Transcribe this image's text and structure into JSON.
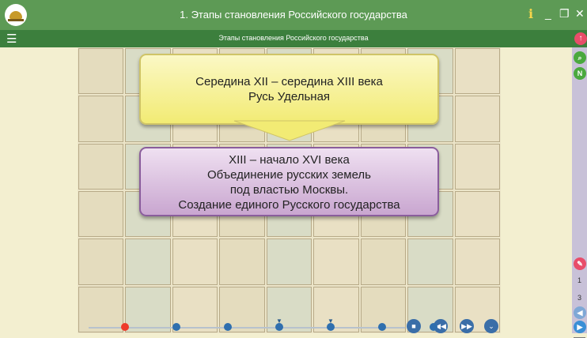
{
  "window": {
    "title": "1. Этапы становления Российского государства",
    "info_label": "i",
    "minimize_label": "_",
    "maximize_label": "❐",
    "close_label": "✕"
  },
  "subbar": {
    "menu_icon": "☰",
    "title": "Этапы становления Российского государства",
    "up_icon": "↑"
  },
  "callouts": [
    {
      "lines": [
        "Середина XII – середина XIII века",
        "Русь Удельная"
      ],
      "color": "#f2eb74"
    },
    {
      "lines": [
        "XIII – начало XVI века",
        "Объединение русских земель",
        "под властью Москвы.",
        "Создание единого Русского государства"
      ],
      "color": "#c9a6d0"
    }
  ],
  "sidebar": {
    "search_icon": "search-icon",
    "notes_label": "N",
    "current_page": "1",
    "total_pages": "3"
  },
  "timeline": {
    "active_color": "#ee3b2b",
    "dot_color": "#2f6fae",
    "dot_count": 7,
    "active_index": 0,
    "marker_indices": [
      3,
      4
    ]
  }
}
